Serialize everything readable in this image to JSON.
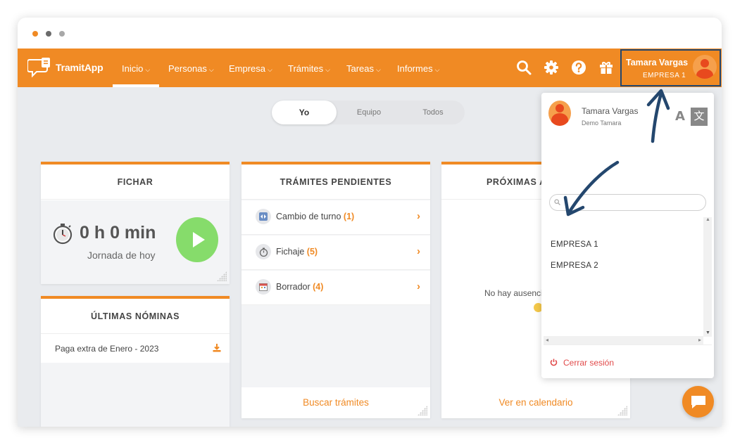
{
  "app": {
    "logo_text": "TramitApp"
  },
  "nav": {
    "items": [
      {
        "label": "Inicio",
        "active": true
      },
      {
        "label": "Personas"
      },
      {
        "label": "Empresa"
      },
      {
        "label": "Trámites"
      },
      {
        "label": "Tareas"
      },
      {
        "label": "Informes"
      }
    ],
    "icons": [
      "search-icon",
      "gear-icon",
      "help-icon",
      "gift-icon"
    ]
  },
  "user": {
    "name": "Tamara Vargas",
    "company": "EMPRESA 1"
  },
  "scope_toggle": {
    "options": [
      "Yo",
      "Equipo",
      "Todos"
    ],
    "selected": "Yo"
  },
  "fichar": {
    "title": "FICHAR",
    "time": "0 h 0 min",
    "caption": "Jornada de hoy"
  },
  "nominas": {
    "title": "ÚLTIMAS NÓMINAS",
    "items": [
      {
        "label": "Paga extra de Enero - 2023"
      }
    ]
  },
  "tramites": {
    "title": "TRÁMITES PENDIENTES",
    "items": [
      {
        "label": "Cambio de turno",
        "count": "(1)"
      },
      {
        "label": "Fichaje",
        "count": "(5)"
      },
      {
        "label": "Borrador",
        "count": "(4)"
      }
    ],
    "footer_link": "Buscar trámites"
  },
  "proximas": {
    "title": "PRÓXIMAS A",
    "empty_text": "No hay ausenci",
    "footer_link": "Ver en calendario"
  },
  "user_menu": {
    "name": "Tamara Vargas",
    "subtitle": "Demo Tamara",
    "search_placeholder": "",
    "companies": [
      "EMPRESA 1",
      "EMPRESA 2"
    ],
    "logout_label": "Cerrar sesión"
  },
  "colors": {
    "brand": "#f08a24",
    "annotation_arrow": "#24476e",
    "logout": "#e14a4a"
  }
}
